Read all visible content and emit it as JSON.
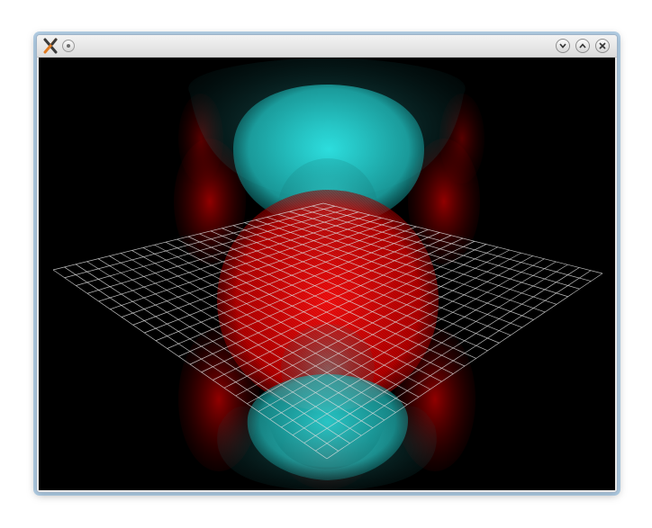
{
  "window": {
    "title": "",
    "icons": {
      "app": "x-app-icon",
      "menu": "window-menu-icon",
      "minimize": "chevron-down-icon",
      "maximize": "chevron-up-icon",
      "close": "close-x-icon"
    }
  },
  "scene": {
    "description_colors": {
      "background": "#000000",
      "cyan_lobe": "#22d6d6",
      "red_lobe": "#e00000",
      "grid": "#d8d8d8"
    }
  }
}
